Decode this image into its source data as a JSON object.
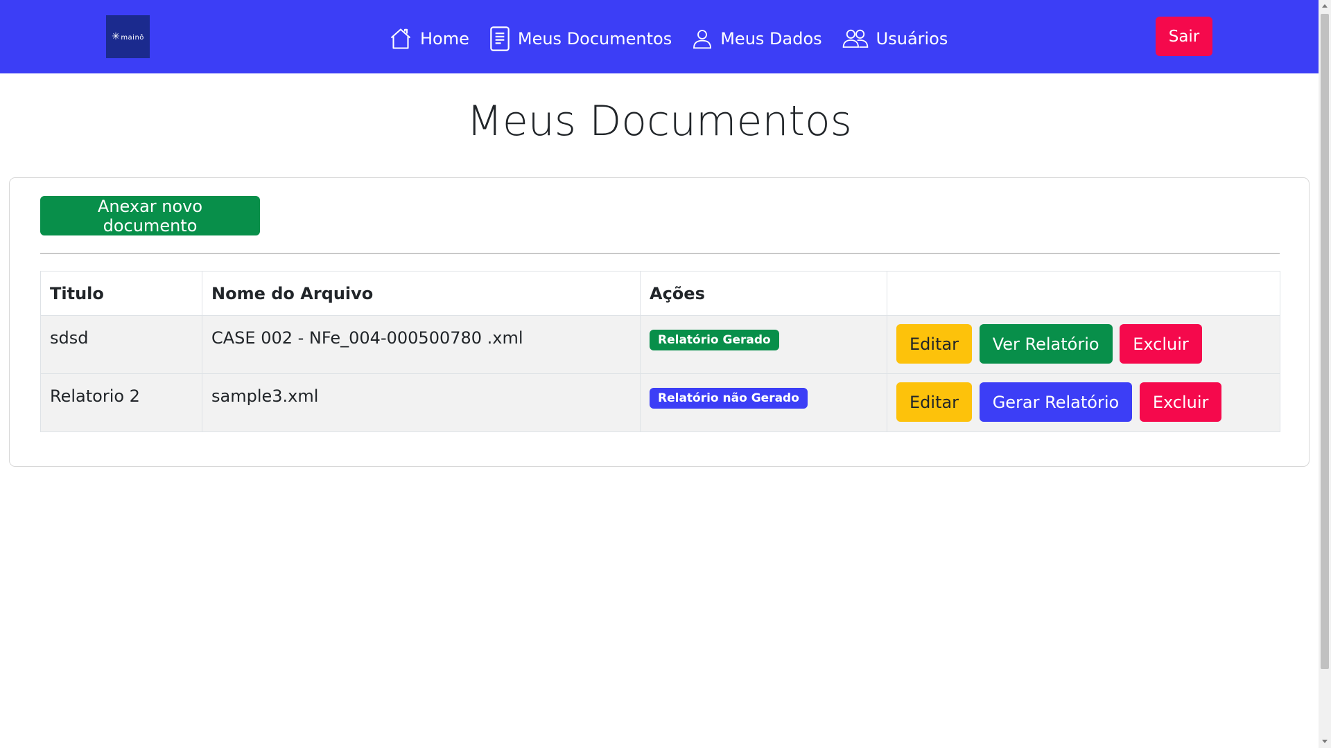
{
  "brand": {
    "logo_text": "mainô"
  },
  "nav": {
    "items": [
      {
        "label": "Home",
        "icon": "home-icon"
      },
      {
        "label": "Meus Documentos",
        "icon": "document-icon"
      },
      {
        "label": "Meus Dados",
        "icon": "person-icon"
      },
      {
        "label": "Usuários",
        "icon": "people-icon"
      }
    ],
    "logout_label": "Sair"
  },
  "page": {
    "title": "Meus Documentos"
  },
  "card": {
    "attach_button_label": "Anexar novo documento"
  },
  "table": {
    "headers": [
      "Titulo",
      "Nome do Arquivo",
      "Ações",
      ""
    ],
    "rows": [
      {
        "title": "sdsd",
        "file": "CASE 002 - NFe_004-000500780 .xml",
        "status": "Relatório Gerado",
        "status_color": "#088f4a",
        "edit": "Editar",
        "report_action": "Ver Relatório",
        "delete": "Excluir"
      },
      {
        "title": "Relatorio 2",
        "file": "sample3.xml",
        "status": "Relatório não Gerado",
        "status_color": "#3c3ef6",
        "edit": "Editar",
        "report_action": "Gerar Relatório",
        "delete": "Excluir"
      }
    ]
  },
  "colors": {
    "navbar": "#3c3ef6",
    "danger": "#f5094c",
    "success": "#088f4a",
    "warning": "#fdc20b",
    "primary": "#3c3ef6"
  }
}
